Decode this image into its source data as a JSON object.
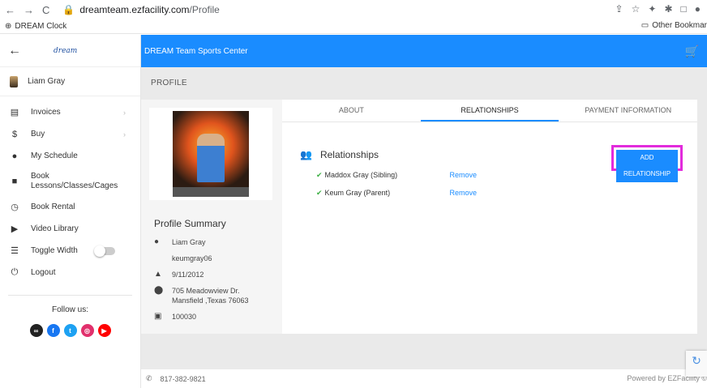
{
  "browser": {
    "url_host": "dreamteam.ezfacility.com",
    "url_path": "/Profile",
    "bookmark": "DREAM Clock",
    "other_bookmarks": "Other Bookmar"
  },
  "sidebar": {
    "logo": "dream",
    "user_name": "Liam Gray",
    "items": [
      {
        "label": "Invoices",
        "icon": "invoice-icon"
      },
      {
        "label": "Buy",
        "icon": "dollar-icon"
      },
      {
        "label": "My Schedule",
        "icon": "person-icon"
      },
      {
        "label": "Book Lessons/Classes/Cages",
        "icon": "book-icon"
      },
      {
        "label": "Book Rental",
        "icon": "timer-icon"
      },
      {
        "label": "Video Library",
        "icon": "video-icon"
      },
      {
        "label": "Toggle Width",
        "icon": "toggle-width-icon"
      },
      {
        "label": "Logout",
        "icon": "power-icon"
      }
    ],
    "follow_label": "Follow us:"
  },
  "topbar": {
    "title": "DREAM Team Sports Center"
  },
  "page": {
    "title": "PROFILE"
  },
  "summary": {
    "title": "Profile Summary",
    "name": "Liam Gray",
    "username": "keumgray06",
    "dob": "9/11/2012",
    "address_line1": "705 Meadowview Dr.",
    "address_line2": "Mansfield ,Texas 76063",
    "member_id": "100030"
  },
  "tabs": [
    {
      "label": "ABOUT"
    },
    {
      "label": "RELATIONSHIPS"
    },
    {
      "label": "PAYMENT INFORMATION"
    }
  ],
  "relationships": {
    "header": "Relationships",
    "add_button": "ADD RELATIONSHIP",
    "rows": [
      {
        "name": "Maddox Gray (Sibling)",
        "action": "Remove"
      },
      {
        "name": "Keum Gray (Parent)",
        "action": "Remove"
      }
    ]
  },
  "footer": {
    "phone": "817-382-9821",
    "powered": "Powered by EZFacility ©"
  },
  "colors": {
    "accent": "#1a8cff",
    "highlight": "#e22bdc",
    "check": "#3cb043"
  }
}
